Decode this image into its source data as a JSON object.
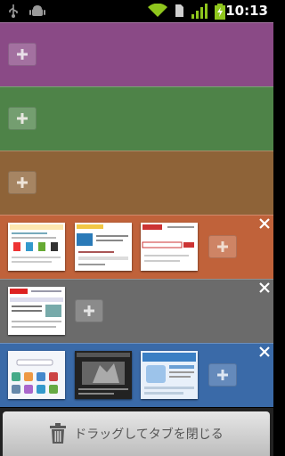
{
  "status_bar": {
    "time": "10:13",
    "icons": [
      "usb-icon",
      "android-debug-icon",
      "wifi-icon",
      "sim-icon",
      "signal-icon",
      "battery-charging-icon"
    ]
  },
  "colors": {
    "purple": "#8a4a86",
    "green": "#4e8348",
    "brown": "#8e6338",
    "orange": "#c0623a",
    "gray": "#6b6b6b",
    "blue": "#3a6aa8"
  },
  "panels": [
    {
      "name": "purple",
      "has_close": false,
      "thumbs": []
    },
    {
      "name": "green",
      "has_close": false,
      "thumbs": []
    },
    {
      "name": "brown",
      "has_close": false,
      "thumbs": []
    },
    {
      "name": "orange",
      "has_close": true,
      "thumbs": [
        "tab-1",
        "tab-2",
        "tab-3"
      ]
    },
    {
      "name": "gray",
      "has_close": true,
      "thumbs": [
        "tab-1"
      ]
    },
    {
      "name": "blue",
      "has_close": true,
      "thumbs": [
        "tab-1",
        "tab-2",
        "tab-3"
      ]
    }
  ],
  "drop_zone": {
    "label": "ドラッグしてタブを閉じる",
    "icon": "trash-icon"
  }
}
